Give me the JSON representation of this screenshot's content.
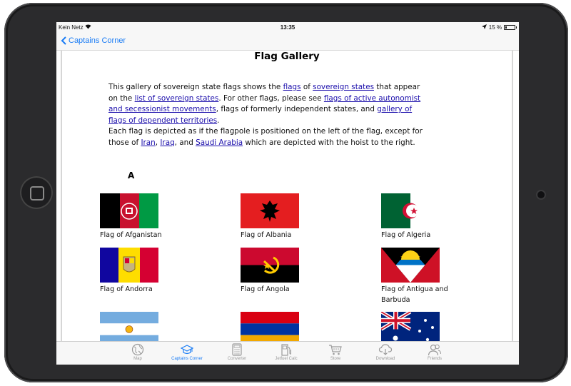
{
  "status_bar": {
    "carrier": "Kein Netz",
    "time": "13:35",
    "battery": "15 %",
    "battery_level": 0.15
  },
  "nav": {
    "back_label": "Captains Corner"
  },
  "page": {
    "title": "Flag Gallery",
    "intro": {
      "t1": "This gallery of sovereign state flags shows the ",
      "link_flags": "flags",
      "t2": " of ",
      "link_sovereign_states": "sovereign states",
      "t3": "  that appear on the ",
      "link_list": "list of sovereign states",
      "t4": ". For other flags, please see ",
      "link_autonomist": "flags of active autonomist and secessionist movements",
      "t5": ", flags of formerly independent states, and ",
      "link_dependent": "gallery of flags of dependent territories",
      "t6": ".",
      "t7": "Each flag is depicted as if the flagpole is positioned on the left of the flag, except for those of ",
      "link_iran": "Iran",
      "t8": ", ",
      "link_iraq": "Iraq",
      "t9": ", and ",
      "link_saudi": "Saudi Arabia",
      "t10": " which are depicted with the hoist to the right."
    },
    "section_letter": "A",
    "flags": [
      {
        "caption": "Flag of Afganistan"
      },
      {
        "caption": "Flag of Albania"
      },
      {
        "caption": "Flag of Algeria"
      },
      {
        "caption": "Flag of Andorra"
      },
      {
        "caption": "Flag of Angola"
      },
      {
        "caption": "Flag of Antigua and Barbuda"
      }
    ]
  },
  "tabs": [
    {
      "label": "Map",
      "icon": "globe-icon"
    },
    {
      "label": "Captains Corner",
      "icon": "captain-hat-icon",
      "active": true
    },
    {
      "label": "Converter",
      "icon": "calculator-icon"
    },
    {
      "label": "Jetfuel Calc",
      "icon": "fuel-pump-icon"
    },
    {
      "label": "Store",
      "icon": "cart-icon"
    },
    {
      "label": "Download",
      "icon": "cloud-download-icon"
    },
    {
      "label": "Friends",
      "icon": "friends-icon"
    }
  ],
  "colors": {
    "accent": "#1a7cf5",
    "link": "#1a0dab",
    "tab_inactive": "#9a9a9a"
  }
}
